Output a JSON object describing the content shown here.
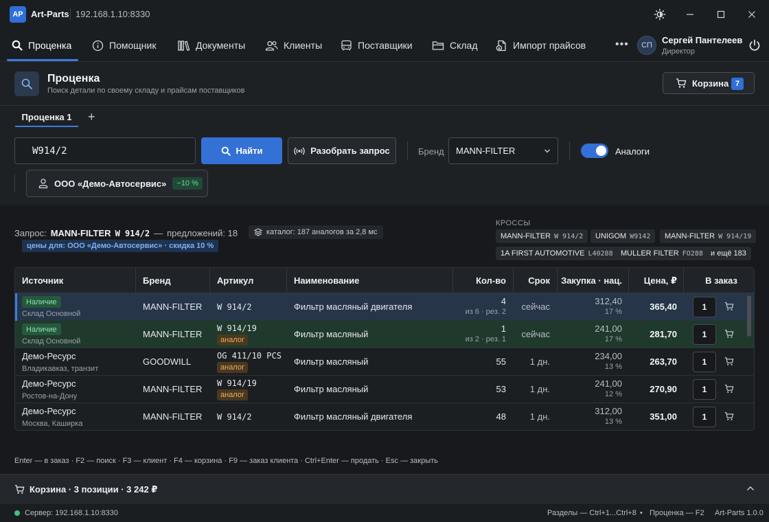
{
  "titlebar": {
    "logo": "AP",
    "app_name": "Art-Parts",
    "host": "192.168.1.10:8330"
  },
  "nav": {
    "items": [
      {
        "label": "Проценка",
        "icon": "search-icon"
      },
      {
        "label": "Помощник",
        "icon": "info-icon"
      },
      {
        "label": "Документы",
        "icon": "books-icon"
      },
      {
        "label": "Клиенты",
        "icon": "users-icon"
      },
      {
        "label": "Поставщики",
        "icon": "bus-icon"
      },
      {
        "label": "Склад",
        "icon": "folder-icon"
      },
      {
        "label": "Импорт прайсов",
        "icon": "file-import-icon"
      }
    ],
    "more": "•••",
    "user": {
      "initials": "СП",
      "name": "Сергей Пантелеев",
      "role": "Директор"
    }
  },
  "header": {
    "title": "Проценка",
    "subtitle": "Поиск детали по своему складу и прайсам поставщиков",
    "cart_label": "Корзина",
    "cart_count": "7"
  },
  "tabs": {
    "active": "Проценка 1",
    "add": "+"
  },
  "search": {
    "query": "W914/2",
    "find_label": "Найти",
    "parse_label": "Разобрать запрос",
    "brand_label": "Бренд",
    "brand_value": "MANN-FILTER",
    "analogs_label": "Аналоги",
    "analogs_on": true,
    "client_name": "ООО «Демо-Автосервис»",
    "client_discount": "−10 %"
  },
  "request": {
    "prefix": "Запрос:",
    "brand": "MANN-FILTER",
    "article": "W 914/2",
    "dash": "—",
    "offers": "предложений: 18",
    "catalog": "каталог: 187 аналогов за 2,8 мс",
    "price_for": "цены для: ООО «Демо-Автосервис» · скидка 10 %"
  },
  "crosses": {
    "title": "КРОССЫ",
    "items": [
      {
        "brand": "MANN-FILTER",
        "article": "W 914/2"
      },
      {
        "brand": "UNIGOM",
        "article": "W9142"
      },
      {
        "brand": "MANN-FILTER",
        "article": "W 914/19"
      },
      {
        "brand": "1A FIRST AUTOMOTIVE",
        "article": "L40288"
      },
      {
        "brand": "MULLER FILTER",
        "article": "FO288"
      }
    ],
    "more": "и ещё 183"
  },
  "table": {
    "headers": [
      "Источник",
      "Бренд",
      "Артикул",
      "Наименование",
      "Кол-во",
      "Срок",
      "Закупка · нац.",
      "Цена, ₽",
      "В заказ"
    ],
    "rows": [
      {
        "badge": "Наличие",
        "source": "",
        "source_sub": "Склад Основной",
        "brand": "MANN-FILTER",
        "article": "W 914/2",
        "analog": "",
        "name": "Фильтр масляный двигателя",
        "qty": "4",
        "qty_sub": "из 6 · рез. 2",
        "term": "сейчас",
        "purchase": "312,40",
        "markup": "17 %",
        "price": "365,40",
        "order_qty": "1",
        "state": "sel"
      },
      {
        "badge": "Наличие",
        "source": "",
        "source_sub": "Склад Основной",
        "brand": "MANN-FILTER",
        "article": "W 914/19",
        "analog": "аналог",
        "name": "Фильтр масляный",
        "qty": "1",
        "qty_sub": "из 2 · рез. 1",
        "term": "сейчас",
        "purchase": "241,00",
        "markup": "17 %",
        "price": "281,70",
        "order_qty": "1",
        "state": "stock"
      },
      {
        "badge": "",
        "source": "Демо-Ресурс",
        "source_sub": "Владикавказ, транзит",
        "brand": "GOODWILL",
        "article": "OG 411/10 PCS",
        "analog": "аналог",
        "name": "Фильтр масляный",
        "qty": "55",
        "qty_sub": "",
        "term": "1 дн.",
        "purchase": "234,00",
        "markup": "13 %",
        "price": "263,70",
        "order_qty": "1",
        "state": ""
      },
      {
        "badge": "",
        "source": "Демо-Ресурс",
        "source_sub": "Ростов-на-Дону",
        "brand": "MANN-FILTER",
        "article": "W 914/19",
        "analog": "аналог",
        "name": "Фильтр масляный",
        "qty": "53",
        "qty_sub": "",
        "term": "1 дн.",
        "purchase": "241,00",
        "markup": "12 %",
        "price": "270,90",
        "order_qty": "1",
        "state": ""
      },
      {
        "badge": "",
        "source": "Демо-Ресурс",
        "source_sub": "Москва, Каширка",
        "brand": "MANN-FILTER",
        "article": "W 914/2",
        "analog": "",
        "name": "Фильтр масляный двигателя",
        "qty": "48",
        "qty_sub": "",
        "term": "1 дн.",
        "purchase": "312,00",
        "markup": "13 %",
        "price": "351,00",
        "order_qty": "1",
        "state": ""
      }
    ]
  },
  "hotkeys": "Enter — в заказ   ·   F2 — поиск   ·   F3 — клиент   ·   F4 — корзина   ·   F9 — заказ клиента   ·   Ctrl+Enter — продать   ·   Esc — закрыть",
  "cart_panel": {
    "title": "Корзина · 3 позиции · 3 242 ₽"
  },
  "status": {
    "server": "Сервер: 192.168.1.10:8330",
    "sections": "Разделы — Ctrl+1...Ctrl+8",
    "bullet": "•",
    "pricing_key": "Проценка — F2",
    "version": "Art-Parts 1.0.0"
  }
}
